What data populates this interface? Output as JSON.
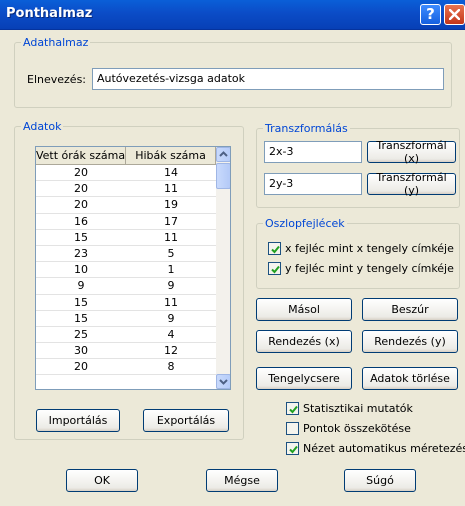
{
  "window": {
    "title": "Ponthalmaz",
    "help_label": "?"
  },
  "dataset": {
    "legend": "Adathalmaz",
    "name_label": "Elnevezés:",
    "name_value": "Autóvezetés-vizsga adatok"
  },
  "data_group": {
    "legend": "Adatok",
    "columns": [
      "Vett órák száma",
      "Hibák száma"
    ],
    "rows": [
      [
        "20",
        "14"
      ],
      [
        "20",
        "11"
      ],
      [
        "20",
        "19"
      ],
      [
        "16",
        "17"
      ],
      [
        "15",
        "11"
      ],
      [
        "23",
        "5"
      ],
      [
        "10",
        "1"
      ],
      [
        "9",
        "9"
      ],
      [
        "15",
        "11"
      ],
      [
        "15",
        "9"
      ],
      [
        "25",
        "4"
      ],
      [
        "30",
        "12"
      ],
      [
        "20",
        "8"
      ]
    ],
    "import_label": "Importálás",
    "export_label": "Exportálás"
  },
  "transform": {
    "legend": "Transzformálás",
    "x_expr": "2x-3",
    "y_expr": "2y-3",
    "x_button": "Transzformál (x)",
    "y_button": "Transzformál (y)"
  },
  "headers": {
    "legend": "Oszlopfejlécek",
    "x_label": "x fejléc mint x tengely címkéje",
    "y_label": "y fejléc mint y tengely címkéje",
    "x_checked": true,
    "y_checked": true
  },
  "actions": {
    "copy": "Másol",
    "insert": "Beszúr",
    "sort_x": "Rendezés (x)",
    "sort_y": "Rendezés (y)",
    "swap_axes": "Tengelycsere",
    "clear_data": "Adatok törlése"
  },
  "options": {
    "stats_label": "Statisztikai mutatók",
    "connect_label": "Pontok összekötése",
    "autosize_label": "Nézet automatikus méretezése",
    "stats_checked": true,
    "connect_checked": false,
    "autosize_checked": true
  },
  "footer": {
    "ok": "OK",
    "cancel": "Mégse",
    "help": "Súgó"
  }
}
